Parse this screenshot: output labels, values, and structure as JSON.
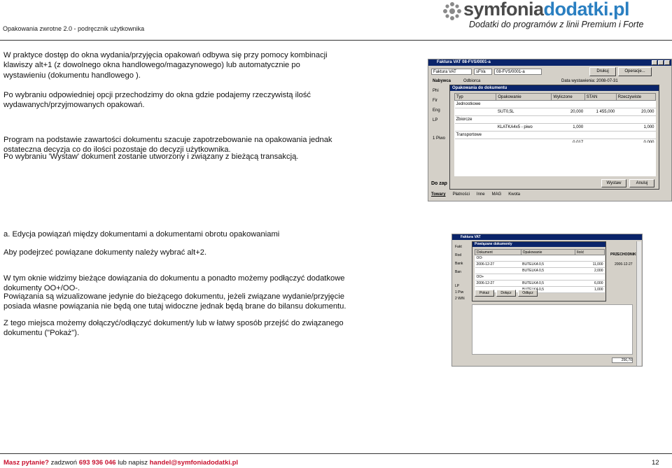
{
  "header": {
    "title": "Opakowania zwrotne 2.0  - podręcznik użytkownika",
    "logo_word_a": "symfonia",
    "logo_word_b": "dodatki.pl",
    "logo_sub": "Dodatki do programów z linii Premium i Forte"
  },
  "body": {
    "p1": "W praktyce dostęp do okna wydania/przyjęcia opakowań odbywa się przy pomocy kombinacji klawiszy alt+1 (z dowolnego okna handlowego/magazynowego) lub automatycznie po wystawieniu (dokumentu handlowego ).",
    "p2": "Po wybraniu odpowiedniej opcji przechodzimy do okna gdzie podajemy rzeczywistą ilość wydawanych/przyjmowanych opakowań.",
    "p3": "Program na podstawie zawartości dokumentu szacuje zapotrzebowanie na opakowania jednak ostateczna decyzja co do ilości pozostaje do decyzji użytkownika.",
    "p4": "Po wybraniu 'Wystaw' dokument zostanie utworzony i związany z bieżącą transakcją.",
    "p5": "a. Edycja powiązań między dokumentami a dokumentami obrotu opakowaniami",
    "p6": "Aby podejrzeć powiązane dokumenty należy wybrać alt+2.",
    "p7": "W tym oknie widzimy bieżące dowiązania do dokumentu a ponadto możemy podłączyć dodatkowe dokumenty OO+/OO-.",
    "p8": "Powiązania są wizualizowane jedynie do bieżącego dokumentu, jeżeli związane wydanie/przyjęcie posiada własne powiązania nie będą one tutaj widoczne jednak będą brane do bilansu dokumentu.",
    "p9": "Z tego miejsca możemy dołączyć/odłączyć dokument/y lub w łatwy sposób przejść do związanego dokumentu (\"Pokaż\")."
  },
  "shot1": {
    "window_title": "Faktura VAT 08-FVS/0001-a",
    "field_type": "Faktura VAT",
    "field_code": "sFVa",
    "field_number": "08-FVS/0001-a",
    "btn_print": "Drukuj",
    "btn_ops": "Operacje...",
    "lbl_buyer": "Nabywca",
    "lbl_recipient": "Odbiorca",
    "lbl_date": "Data wystawienia: 2008-07-31",
    "dialog_title": "Opakowania do dokumentu",
    "columns": [
      "Typ",
      "Opakowanie",
      "Wyliczone",
      "STAN",
      "Rzeczywiste"
    ],
    "rows": [
      [
        "Jednostkowe",
        "",
        "",
        "",
        ""
      ],
      [
        "",
        "SUT0,5L",
        "20,000",
        "1 455,000",
        "20,000"
      ],
      [
        "Zbiorcze",
        "",
        "",
        "",
        ""
      ],
      [
        "",
        "KLATKA4x5 - piwo",
        "1,000",
        "",
        "1,000"
      ],
      [
        "Transportowe",
        "",
        "",
        "",
        ""
      ],
      [
        "",
        "",
        "0,017",
        "",
        "0,000"
      ]
    ],
    "side_labels": [
      "Phi",
      "Fir",
      "Eng",
      "LP",
      "1 Piwo"
    ],
    "btn_issue": "Wystaw",
    "btn_cancel": "Anuluj",
    "bottom_label": "Do zap",
    "tabs": [
      "Towary",
      "Płatności",
      "Inne",
      "MAG",
      "Kwota"
    ]
  },
  "shot2": {
    "window_title": "Faktura VAT",
    "dialog_title": "Powiązane dokumenty",
    "columns": [
      "Dokument",
      "Opakowanie",
      "Ilość"
    ],
    "rows": [
      [
        "OO-",
        "",
        ""
      ],
      [
        "2006-12-27",
        "BUTELKA 0,5",
        "11,000"
      ],
      [
        "",
        "BUTELKA 0,5",
        "2,000"
      ],
      [
        "OO+",
        "",
        ""
      ],
      [
        "2006-12-27",
        "BUTELKA 0,5",
        "6,000"
      ],
      [
        "",
        "BUTELKA 0,5",
        "1,000"
      ]
    ],
    "side_labels": [
      "Fakt",
      "Rod",
      "Bank",
      "Ban",
      "LP",
      "1 Piw",
      "2 WiN"
    ],
    "btn_show": "Pokaż",
    "btn_attach": "Dołącz",
    "btn_detach": "Odłącz",
    "lbl_right1": "PRZECHODNIKU",
    "lbl_date": "2006-12-27",
    "lbl_total": "256,70"
  },
  "footer": {
    "question": "Masz pytanie?",
    "call": " zadzwoń ",
    "phone": "693 936 046",
    "or_write": " lub napisz ",
    "email": "handel@symfoniadodatki.pl",
    "page": "12"
  },
  "colors": {
    "brand_blue": "#2a7fc1",
    "footer_red": "#c8102e",
    "titlebar": "#0a246a"
  }
}
